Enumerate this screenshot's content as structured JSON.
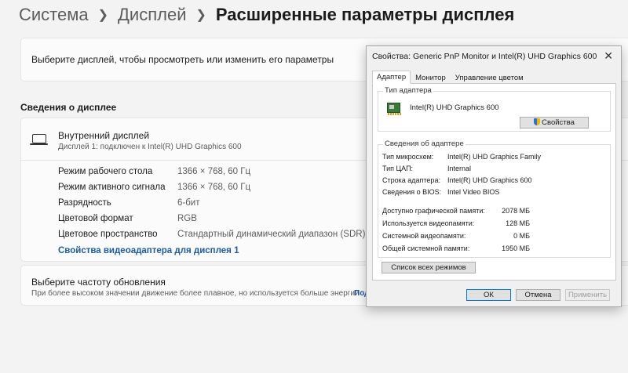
{
  "breadcrumb": {
    "item1": "Система",
    "item2": "Дисплей",
    "current": "Расширенные параметры дисплея"
  },
  "select_card": {
    "text": "Выберите дисплей, чтобы просмотреть или изменить его параметры"
  },
  "section_title": "Сведения о дисплее",
  "display": {
    "name": "Внутренний дисплей",
    "subtitle": "Дисплей 1: подключен к Intel(R) UHD Graphics 600",
    "props": [
      {
        "label": "Режим рабочего стола",
        "value": "1366 × 768, 60 Гц"
      },
      {
        "label": "Режим активного сигнала",
        "value": "1366 × 768, 60 Гц"
      },
      {
        "label": "Разрядность",
        "value": "6-бит"
      },
      {
        "label": "Цветовой формат",
        "value": "RGB"
      },
      {
        "label": "Цветовое пространство",
        "value": "Стандартный динамический диапазон (SDR)"
      }
    ],
    "adapter_link": "Свойства видеоадаптера для дисплея 1"
  },
  "refresh": {
    "title": "Выберите частоту обновления",
    "subtitle": "При более высоком значении движение более плавное, но используется больше энергии",
    "link_fragment": "Под"
  },
  "dialog": {
    "title": "Свойства: Generic PnP Monitor и Intel(R) UHD Graphics 600",
    "close": "✕",
    "tabs": [
      "Адаптер",
      "Монитор",
      "Управление цветом"
    ],
    "adapter_type_label": "Тип адаптера",
    "adapter_name": "Intel(R) UHD Graphics 600",
    "properties_button": "Свойства",
    "adapter_info_label": "Сведения об адаптере",
    "info": [
      {
        "label": "Тип микросхем:",
        "value": "Intel(R) UHD Graphics Family"
      },
      {
        "label": "Тип ЦАП:",
        "value": "Internal"
      },
      {
        "label": "Строка адаптера:",
        "value": "Intel(R) UHD Graphics 600"
      },
      {
        "label": "Сведения о BIOS:",
        "value": "Intel Video BIOS"
      }
    ],
    "memory": [
      {
        "label": "Доступно графической памяти:",
        "value": "2078 МБ"
      },
      {
        "label": "Используется видеопамяти:",
        "value": "128 МБ"
      },
      {
        "label": "Системной видеопамяти:",
        "value": "0 МБ"
      },
      {
        "label": "Общей системной памяти:",
        "value": "1950 МБ"
      }
    ],
    "list_modes_button": "Список всех режимов",
    "ok_button": "ОК",
    "cancel_button": "Отмена",
    "apply_button": "Применить"
  }
}
